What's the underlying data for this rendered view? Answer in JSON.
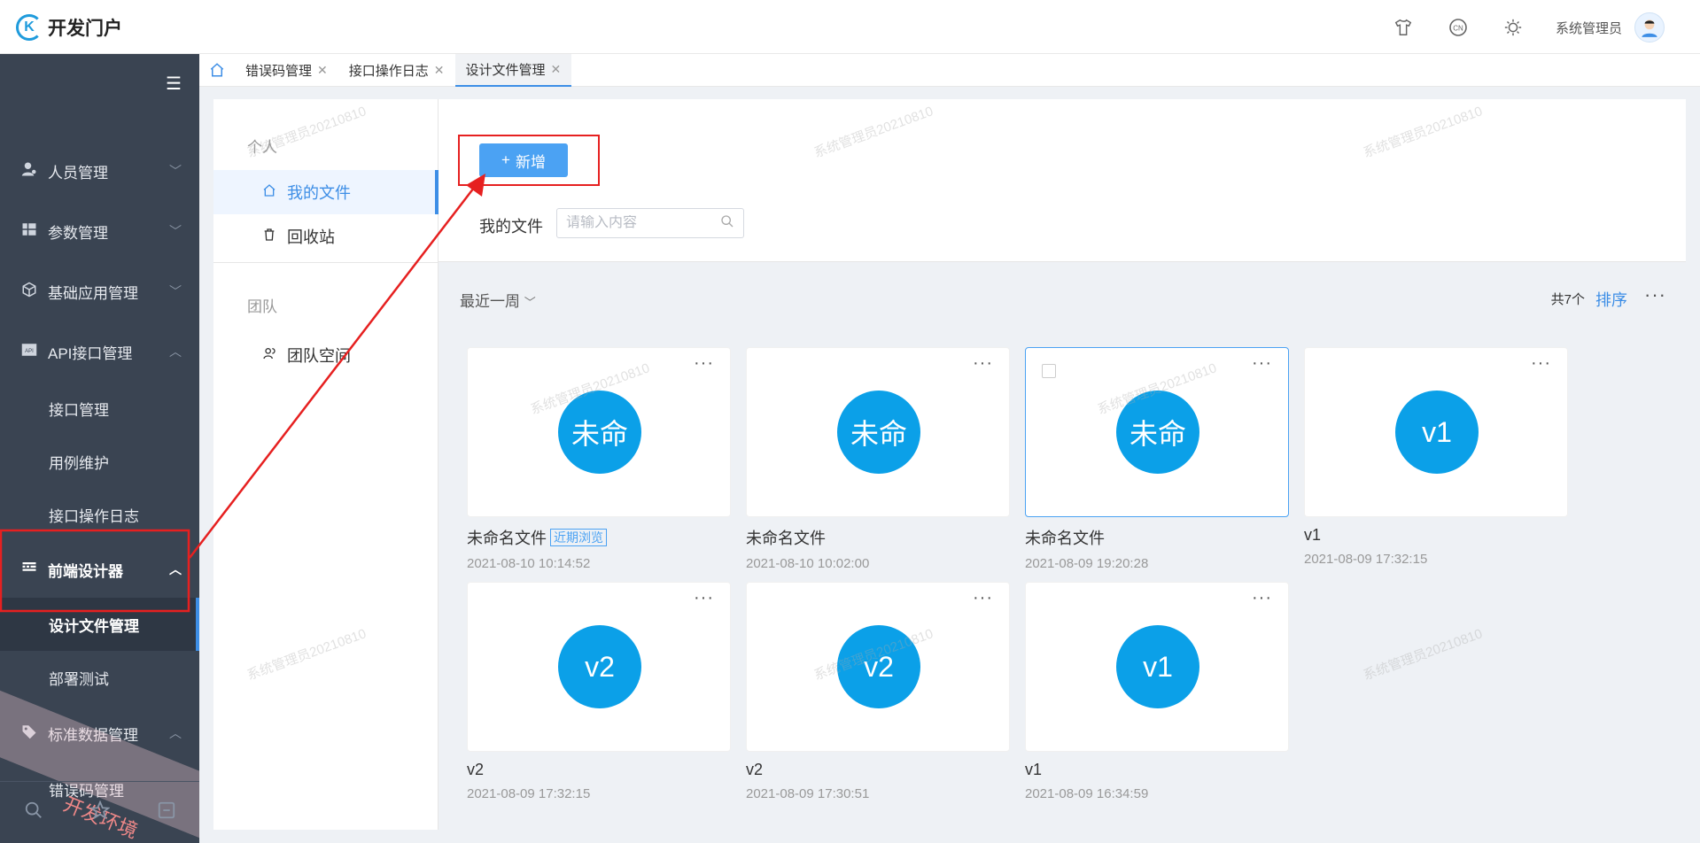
{
  "app": {
    "logo_mark": "K",
    "title": "开发门户",
    "username": "系统管理员"
  },
  "topbar_icons": [
    "tshirt-icon",
    "language-icon",
    "sun-icon"
  ],
  "language_label": "CN",
  "sidebar": {
    "items": [
      {
        "label": "人员管理",
        "icon": "person-icon"
      },
      {
        "label": "参数管理",
        "icon": "grid-icon"
      },
      {
        "label": "基础应用管理",
        "icon": "cube-icon"
      },
      {
        "label": "API接口管理",
        "icon": "api-icon"
      }
    ],
    "api_sub": [
      "接口管理",
      "用例维护",
      "接口操作日志"
    ],
    "frontend": {
      "label": "前端设计器",
      "icon": "keyboard-icon"
    },
    "frontend_sub": [
      "设计文件管理",
      "部署测试"
    ],
    "std": {
      "label": "标准数据管理",
      "icon": "tag-icon"
    },
    "std_sub": [
      "错误码管理"
    ],
    "corner_stamp": "开发环境"
  },
  "tabs": [
    {
      "label": "错误码管理"
    },
    {
      "label": "接口操作日志"
    },
    {
      "label": "设计文件管理",
      "active": true
    }
  ],
  "panel": {
    "personal": "个人",
    "my_files": "我的文件",
    "recycle": "回收站",
    "team": "团队",
    "team_space": "团队空间"
  },
  "main": {
    "add_label": "新增",
    "my_files_label": "我的文件",
    "search_placeholder": "请输入内容",
    "period": "最近一周",
    "total": "共7个",
    "sort": "排序"
  },
  "watermark": "系统管理员20210810",
  "files": [
    {
      "avatar": "未命",
      "name": "未命名文件",
      "badge": "近期浏览",
      "time": "2021-08-10 10:14:52"
    },
    {
      "avatar": "未命",
      "name": "未命名文件",
      "time": "2021-08-10 10:02:00"
    },
    {
      "avatar": "未命",
      "name": "未命名文件",
      "time": "2021-08-09 19:20:28",
      "selected": true
    },
    {
      "avatar": "v1",
      "name": "v1",
      "time": "2021-08-09 17:32:15"
    },
    {
      "avatar": "v2",
      "name": "v2",
      "time": "2021-08-09 17:32:15"
    },
    {
      "avatar": "v2",
      "name": "v2",
      "time": "2021-08-09 17:30:51"
    },
    {
      "avatar": "v1",
      "name": "v1",
      "time": "2021-08-09 16:34:59"
    }
  ],
  "colors": {
    "accent": "#3d8ee6",
    "sidebar_bg": "#3a4452",
    "card_circle": "#0ba0e8",
    "annotation": "#e62020"
  }
}
